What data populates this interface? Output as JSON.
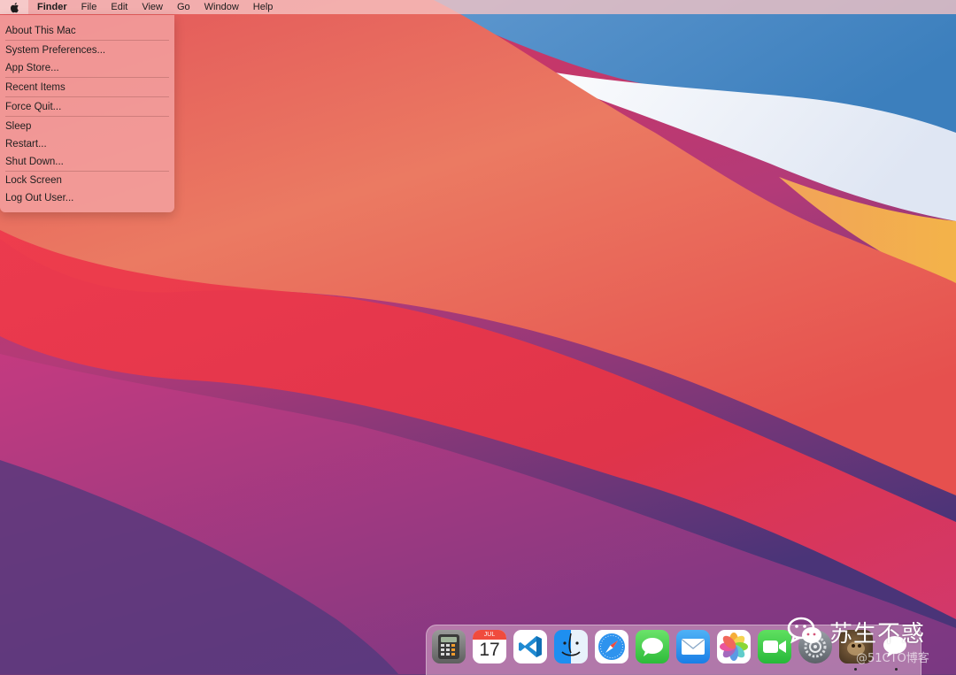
{
  "menubar": {
    "app_name": "Finder",
    "items": [
      "File",
      "Edit",
      "View",
      "Go",
      "Window",
      "Help"
    ]
  },
  "apple_menu": {
    "items": [
      "About This Mac",
      "System Preferences...",
      "App Store...",
      "Recent Items",
      "Force Quit...",
      "Sleep",
      "Restart...",
      "Shut Down...",
      "Lock Screen",
      "Log Out User..."
    ]
  },
  "dock": {
    "calendar_month": "JUL",
    "calendar_day": "17",
    "apps": [
      {
        "name": "calculator-icon"
      },
      {
        "name": "calendar-icon"
      },
      {
        "name": "vscode-icon"
      },
      {
        "name": "finder-icon"
      },
      {
        "name": "safari-icon"
      },
      {
        "name": "messages-icon"
      },
      {
        "name": "mail-icon"
      },
      {
        "name": "photos-icon"
      },
      {
        "name": "facetime-icon"
      },
      {
        "name": "system-preferences-icon"
      },
      {
        "name": "photo-thumbnail-icon"
      },
      {
        "name": "wechat-icon"
      }
    ]
  },
  "watermark": {
    "name": "苏生不惑",
    "blog": "@51CTO博客"
  },
  "colors": {
    "menu_bg": "#f4a4a4",
    "wallpaper_red": "#e8374a",
    "wallpaper_blue": "#3f86c4"
  }
}
